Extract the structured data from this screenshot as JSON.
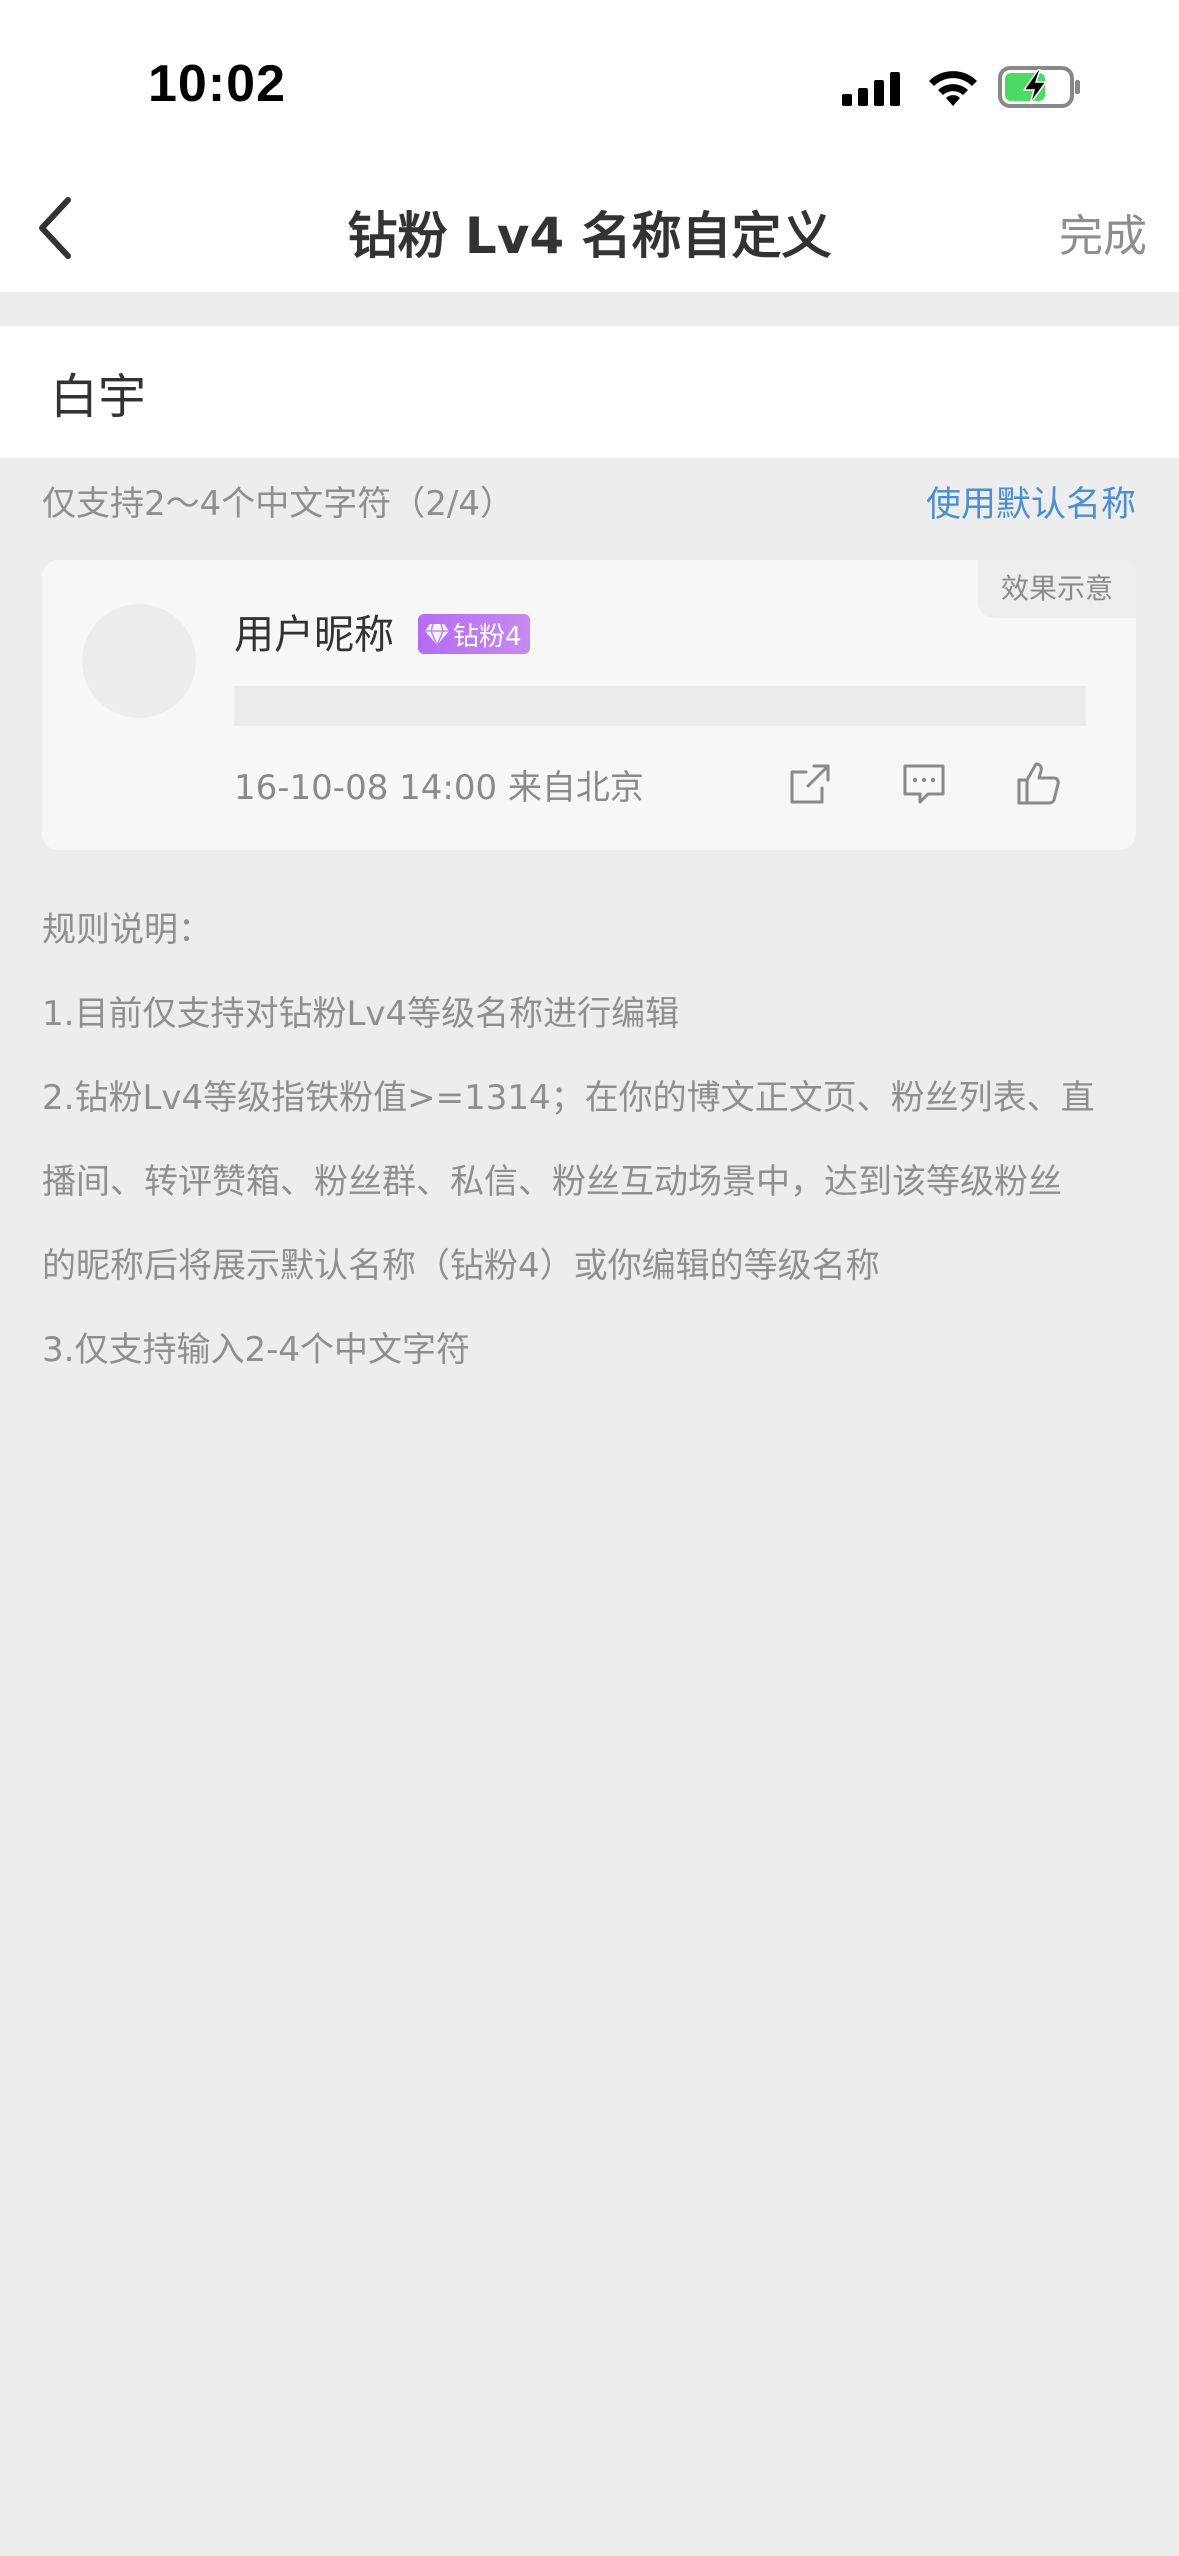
{
  "status_bar": {
    "time": "10:02",
    "icons": [
      "cellular-signal-icon",
      "wifi-icon",
      "battery-charging-icon"
    ]
  },
  "nav": {
    "title": "钻粉 Lv4 名称自定义",
    "done_label": "完成",
    "back_icon": "chevron-left-icon"
  },
  "input": {
    "value": "白宇",
    "placeholder": ""
  },
  "hint": {
    "text": "仅支持2～4个中文字符（2/4）",
    "use_default_label": "使用默认名称"
  },
  "preview": {
    "tag": "效果示意",
    "nickname": "用户昵称",
    "badge_label": "钻粉4",
    "badge_icon": "diamond-icon",
    "meta": "16-10-08 14:00 来自北京",
    "actions": [
      "share-icon",
      "comment-icon",
      "like-icon"
    ],
    "colors": {
      "badge_start": "#b46cf5",
      "badge_end": "#c78af0",
      "link": "#4a8fd3"
    }
  },
  "rules": {
    "title": "规则说明：",
    "items": [
      "1.目前仅支持对钻粉Lv4等级名称进行编辑",
      "2.钻粉Lv4等级指铁粉值>=1314；在你的博文正文页、粉丝列表、直",
      "播间、转评赞箱、粉丝群、私信、粉丝互动场景中，达到该等级粉丝",
      "的昵称后将展示默认名称（钻粉4）或你编辑的等级名称",
      "3.仅支持输入2-4个中文字符"
    ]
  }
}
